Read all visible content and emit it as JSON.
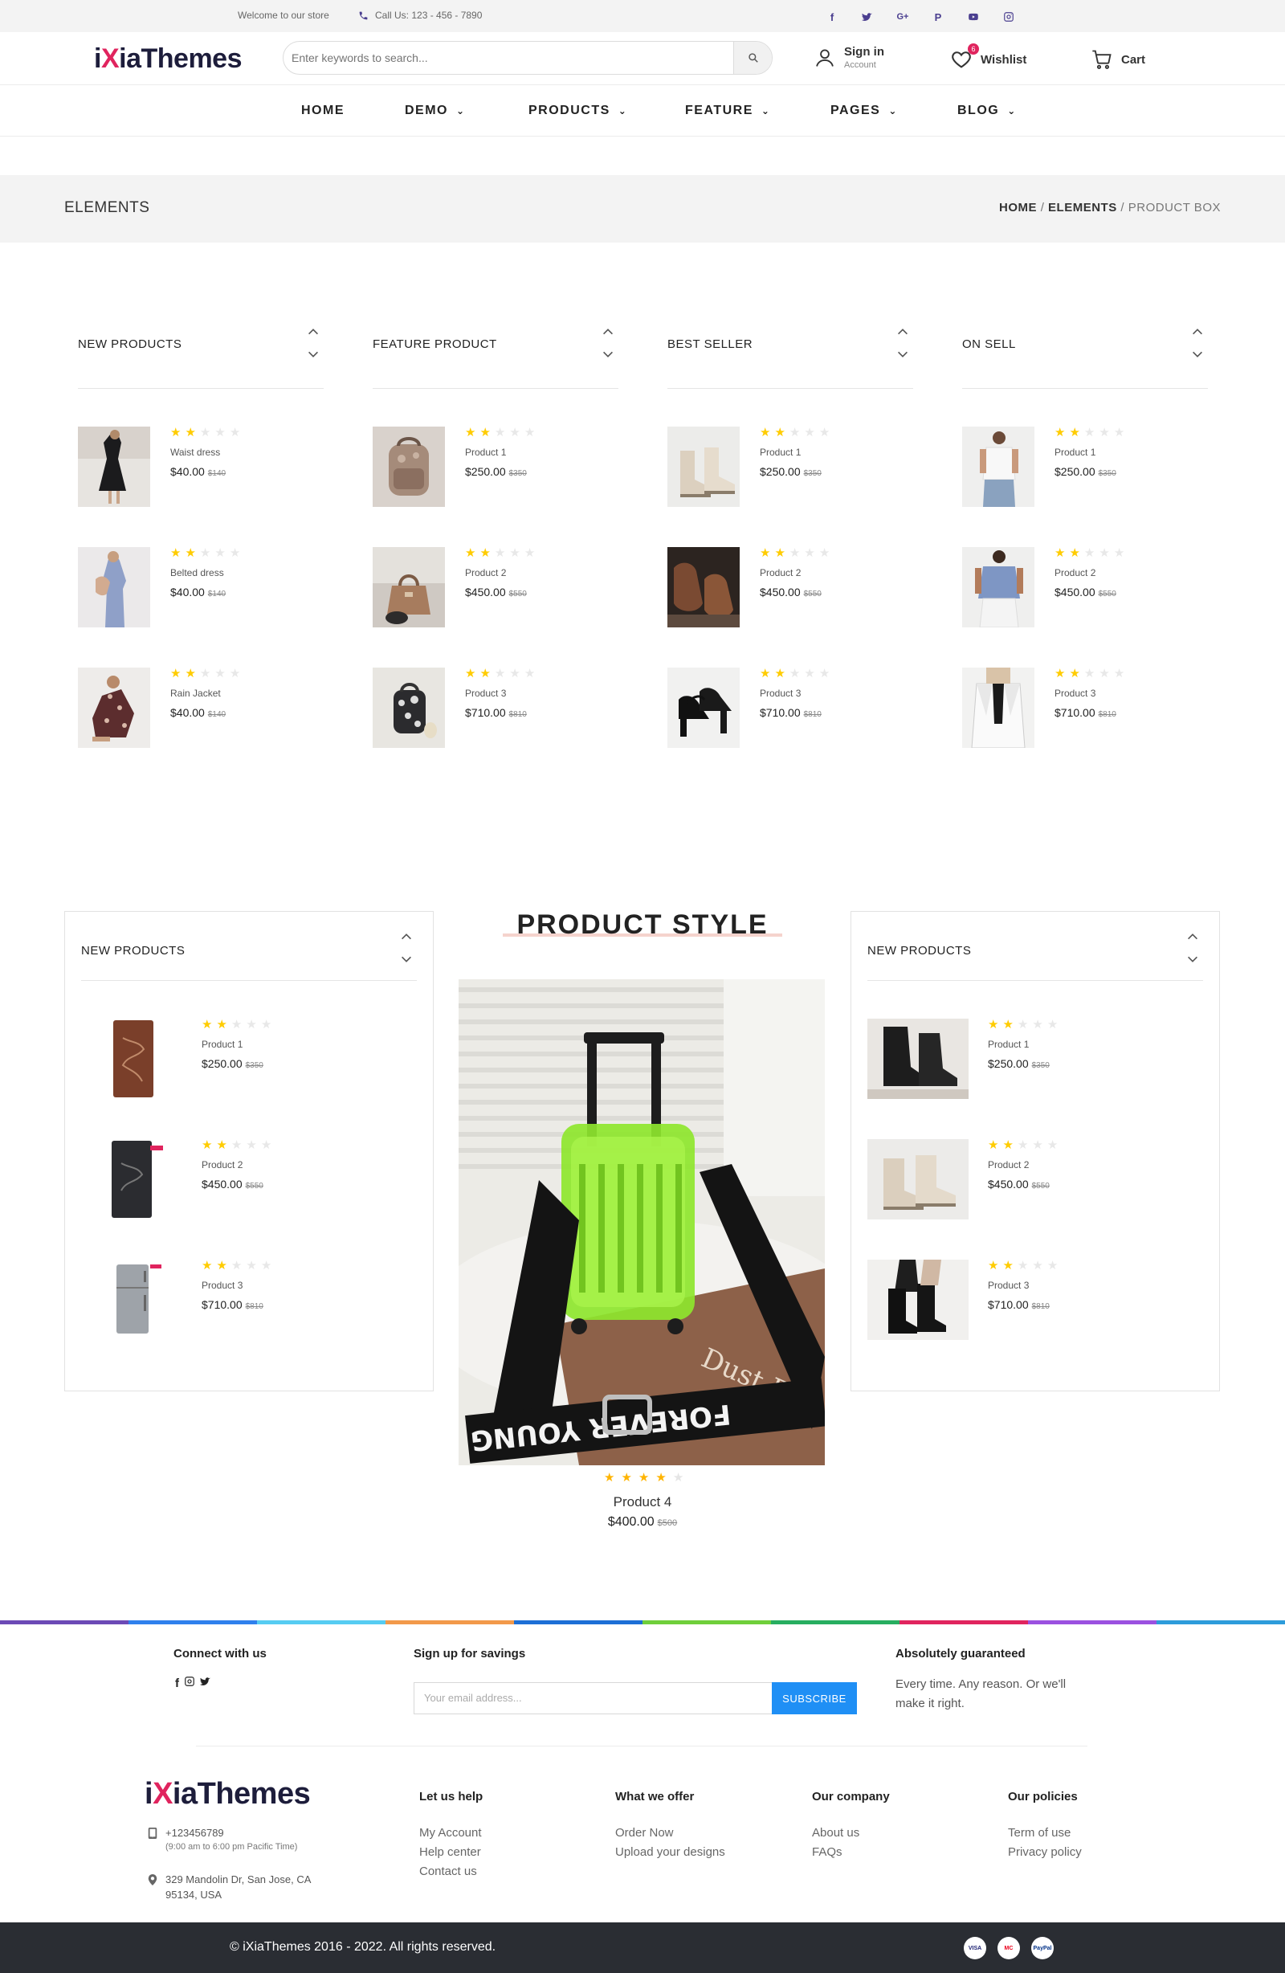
{
  "topbar": {
    "welcome": "Welcome to our store",
    "phone": "Call Us: 123 - 456 - 7890",
    "social_icons": [
      "facebook-icon",
      "twitter-icon",
      "google-plus-icon",
      "pinterest-icon",
      "youtube-icon",
      "instagram-icon"
    ],
    "icon_color": "#4a3e8f"
  },
  "header": {
    "logo_prefix": "i",
    "logo_x": "X",
    "logo_suffix": "iaThemes",
    "search_placeholder": "Enter keywords to search...",
    "signin_label": "Sign in",
    "signin_sub": "Account",
    "wishlist_label": "Wishlist",
    "wishlist_count": "6",
    "cart_label": "Cart",
    "brand_color": "#e0245e"
  },
  "nav": {
    "items": [
      {
        "label": "HOME",
        "dropdown": false
      },
      {
        "label": "DEMO",
        "dropdown": true
      },
      {
        "label": "PRODUCTS",
        "dropdown": true
      },
      {
        "label": "FEATURE",
        "dropdown": true
      },
      {
        "label": "PAGES",
        "dropdown": true
      },
      {
        "label": "BLOG",
        "dropdown": true
      }
    ]
  },
  "breadcrumb": {
    "title": "ELEMENTS",
    "home": "HOME",
    "sep": "/",
    "elements": "ELEMENTS",
    "current": "PRODUCT BOX"
  },
  "columns": [
    {
      "title": "NEW PRODUCTS",
      "products": [
        {
          "name": "Waist dress",
          "price": "$40.00",
          "old_price": "$140",
          "rating": 2
        },
        {
          "name": "Belted dress",
          "price": "$40.00",
          "old_price": "$140",
          "rating": 2
        },
        {
          "name": "Rain Jacket",
          "price": "$40.00",
          "old_price": "$140",
          "rating": 2
        }
      ]
    },
    {
      "title": "FEATURE PRODUCT",
      "products": [
        {
          "name": "Product 1",
          "price": "$250.00",
          "old_price": "$350",
          "rating": 2
        },
        {
          "name": "Product 2",
          "price": "$450.00",
          "old_price": "$550",
          "rating": 2
        },
        {
          "name": "Product 3",
          "price": "$710.00",
          "old_price": "$810",
          "rating": 2
        }
      ]
    },
    {
      "title": "BEST SELLER",
      "products": [
        {
          "name": "Product 1",
          "price": "$250.00",
          "old_price": "$350",
          "rating": 2
        },
        {
          "name": "Product 2",
          "price": "$450.00",
          "old_price": "$550",
          "rating": 2
        },
        {
          "name": "Product 3",
          "price": "$710.00",
          "old_price": "$810",
          "rating": 2
        }
      ]
    },
    {
      "title": "ON SELL",
      "products": [
        {
          "name": "Product 1",
          "price": "$250.00",
          "old_price": "$350",
          "rating": 2
        },
        {
          "name": "Product 2",
          "price": "$450.00",
          "old_price": "$550",
          "rating": 2
        },
        {
          "name": "Product 3",
          "price": "$710.00",
          "old_price": "$810",
          "rating": 2
        }
      ]
    }
  ],
  "product_style": {
    "title": "PRODUCT STYLE",
    "left_box": {
      "title": "NEW PRODUCTS",
      "products": [
        {
          "name": "Product 1",
          "price": "$250.00",
          "old_price": "$350",
          "rating": 2
        },
        {
          "name": "Product 2",
          "price": "$450.00",
          "old_price": "$550",
          "rating": 2
        },
        {
          "name": "Product 3",
          "price": "$710.00",
          "old_price": "$810",
          "rating": 2
        }
      ]
    },
    "right_box": {
      "title": "NEW PRODUCTS",
      "products": [
        {
          "name": "Product 1",
          "price": "$250.00",
          "old_price": "$350",
          "rating": 2
        },
        {
          "name": "Product 2",
          "price": "$450.00",
          "old_price": "$550",
          "rating": 2
        },
        {
          "name": "Product 3",
          "price": "$710.00",
          "old_price": "$810",
          "rating": 2
        }
      ]
    },
    "feature": {
      "name": "Product 4",
      "price": "$400.00",
      "old_price": "$500",
      "rating": 4,
      "strap_text": "FOREVER YOUNG",
      "box_text": "Dust Bag"
    }
  },
  "footer": {
    "connect_title": "Connect with us",
    "signup_title": "Sign up for savings",
    "email_placeholder": "Your email address...",
    "subscribe_label": "SUBSCRIBE",
    "guarantee_title": "Absolutely guaranteed",
    "guarantee_text": "Every time. Any reason. Or we'll make it right.",
    "phone": "+123456789",
    "hours": "(9:00 am to 6:00 pm Pacific Time)",
    "address": "329 Mandolin Dr, San Jose, CA 95134, USA",
    "help_title": "Let us help",
    "help_links": [
      "My Account",
      "Help center",
      "Contact us"
    ],
    "offer_title": "What we offer",
    "offer_links": [
      "Order Now",
      "Upload your designs"
    ],
    "company_title": "Our company",
    "company_links": [
      "About us",
      "FAQs"
    ],
    "policies_title": "Our policies",
    "policies_links": [
      "Term of use",
      "Privacy policy"
    ],
    "copyright": "© iXiaThemes 2016 - 2022. All rights reserved.",
    "payment_icons": [
      "visa-icon",
      "mastercard-icon",
      "paypal-icon"
    ],
    "payment_labels": [
      "VISA",
      "MC",
      "PayPal"
    ],
    "subscribe_color": "#1f8ff5",
    "rainbow_colors": [
      "#6c4ab6",
      "#2f80ed",
      "#56ccf2",
      "#f2994a",
      "#1d6fd6",
      "#6fcf3a",
      "#27ae60",
      "#e0245e",
      "#9b51e0",
      "#2d9cdb"
    ]
  }
}
